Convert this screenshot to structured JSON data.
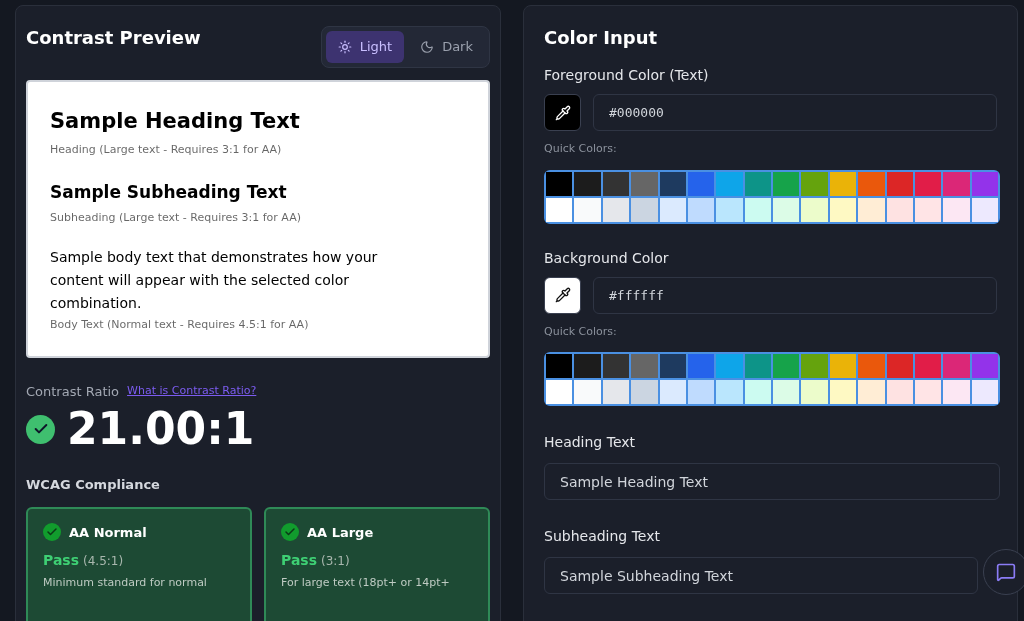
{
  "preview_panel": {
    "title": "Contrast Preview",
    "theme_toggle": [
      {
        "label": "Light",
        "kind": "sun",
        "selected": true
      },
      {
        "label": "Dark",
        "kind": "moon",
        "selected": false
      }
    ],
    "sample": {
      "heading": "Sample Heading Text",
      "heading_note": "Heading (Large text - Requires 3:1 for AA)",
      "subheading": "Sample Subheading Text",
      "subheading_note": "Subheading (Large text - Requires 3:1 for AA)",
      "body": "Sample body text that demonstrates how your content will appear with the selected color combination.",
      "body_note": "Body Text (Normal text - Requires 4.5:1 for AA)"
    },
    "ratio_label": "Contrast Ratio",
    "ratio_link": "What is Contrast Ratio?",
    "ratio": "21.00:1",
    "ratio_pass": true,
    "compliance_title": "WCAG Compliance",
    "compliance": [
      {
        "title": "AA Normal",
        "pass": true,
        "status": "Pass",
        "requirement": "(4.5:1)",
        "description": "Minimum standard for normal"
      },
      {
        "title": "AA Large",
        "pass": true,
        "status": "Pass",
        "requirement": "(3:1)",
        "description": "For large text (18pt+ or 14pt+"
      }
    ]
  },
  "input_panel": {
    "title": "Color Input",
    "color_fields": [
      {
        "label": "Foreground Color (Text)",
        "value": "#000000",
        "quick_label": "Quick Colors:"
      },
      {
        "label": "Background Color",
        "value": "#ffffff",
        "quick_label": "Quick Colors:"
      }
    ],
    "quick_colors": [
      {
        "color": "#000000"
      },
      {
        "color": "#1c1c1c"
      },
      {
        "color": "#333333"
      },
      {
        "color": "#666666"
      },
      {
        "color": "#1e3a5f"
      },
      {
        "color": "#2563eb"
      },
      {
        "color": "#0ea5e9"
      },
      {
        "color": "#0d9488"
      },
      {
        "color": "#16a34a"
      },
      {
        "color": "#65a30d"
      },
      {
        "color": "#eab308"
      },
      {
        "color": "#ea580c"
      },
      {
        "color": "#dc2626"
      },
      {
        "color": "#e11d48"
      },
      {
        "color": "#db2777"
      },
      {
        "color": "#9333ea"
      },
      {
        "color": "#ffffff"
      },
      {
        "color": "#f9fafb"
      },
      {
        "color": "#e5e7eb"
      },
      {
        "color": "#cbd5e1"
      },
      {
        "color": "#dbeafe"
      },
      {
        "color": "#bfdbfe"
      },
      {
        "color": "#bae6fd"
      },
      {
        "color": "#ccfbf1"
      },
      {
        "color": "#dcfce7"
      },
      {
        "color": "#ecfccb"
      },
      {
        "color": "#fef9c3"
      },
      {
        "color": "#ffedd5"
      },
      {
        "color": "#fee2e2"
      },
      {
        "color": "#ffe4e6"
      },
      {
        "color": "#fce7f3"
      },
      {
        "color": "#ede9fe"
      }
    ],
    "text_fields": [
      {
        "label": "Heading Text",
        "value": "Sample Heading Text"
      },
      {
        "label": "Subheading Text",
        "value": "Sample Subheading Text"
      }
    ]
  }
}
